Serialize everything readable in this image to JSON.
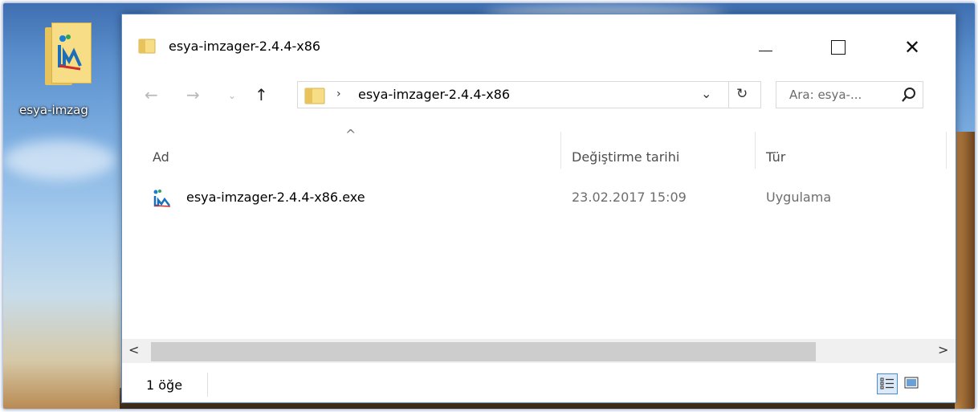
{
  "desktop": {
    "icon_label": "esya-imzag"
  },
  "window": {
    "title": "esya-imzager-2.4.4-x86",
    "minimize_icon": "minimize-icon",
    "maximize_icon": "maximize-icon",
    "close_label": "✕"
  },
  "nav": {
    "back_glyph": "←",
    "forward_glyph": "→",
    "recent_glyph": "⌄",
    "up_glyph": "↑",
    "address_separator": "›",
    "address_path": "esya-imzager-2.4.4-x86",
    "address_dropdown": "⌄",
    "refresh_glyph": "↻",
    "search_placeholder": "Ara: esya-..."
  },
  "columns": {
    "sort_indicator": "^",
    "name": "Ad",
    "date": "Değiştirme tarihi",
    "type": "Tür"
  },
  "files": [
    {
      "name": "esya-imzager-2.4.4-x86.exe",
      "modified": "23.02.2017 15:09",
      "type": "Uygulama"
    }
  ],
  "scrollbar": {
    "left_glyph": "<",
    "right_glyph": ">"
  },
  "status": {
    "item_count": "1 öğe"
  },
  "colors": {
    "accent": "#4a8bd6",
    "folder": "#f7dd86",
    "window_border": "#5a8bc8"
  }
}
